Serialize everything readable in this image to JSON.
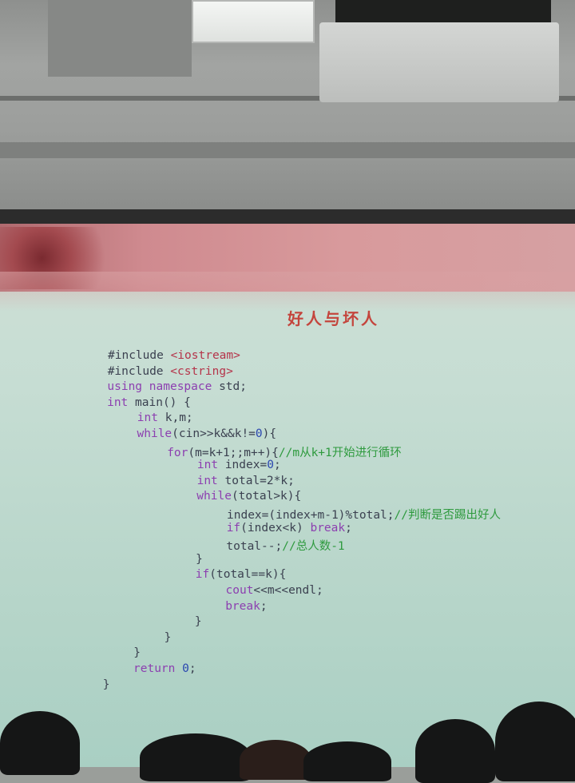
{
  "slide": {
    "title": "好人与坏人",
    "code_lines": [
      {
        "indent": 0,
        "parts": [
          {
            "t": "#include ",
            "c": "plain"
          },
          {
            "t": "<iostream>",
            "c": "str"
          }
        ]
      },
      {
        "indent": 0,
        "parts": [
          {
            "t": "#include ",
            "c": "plain"
          },
          {
            "t": "<cstring>",
            "c": "str"
          }
        ]
      },
      {
        "indent": 0,
        "parts": [
          {
            "t": "using namespace",
            "c": "kw"
          },
          {
            "t": " std;",
            "c": "plain"
          }
        ]
      },
      {
        "indent": 0,
        "parts": [
          {
            "t": "int",
            "c": "kw"
          },
          {
            "t": " main() {",
            "c": "plain"
          }
        ]
      },
      {
        "indent": 1,
        "parts": [
          {
            "t": "int",
            "c": "kw"
          },
          {
            "t": " k,m;",
            "c": "plain"
          }
        ]
      },
      {
        "indent": 1,
        "parts": [
          {
            "t": "while",
            "c": "kw"
          },
          {
            "t": "(cin>>k&&k!=",
            "c": "plain"
          },
          {
            "t": "0",
            "c": "num"
          },
          {
            "t": "){",
            "c": "plain"
          }
        ]
      },
      {
        "indent": 2,
        "parts": [
          {
            "t": "for",
            "c": "kw"
          },
          {
            "t": "(m=k+1;;m++){",
            "c": "plain"
          },
          {
            "t": "//m从k+1开始进行循环",
            "c": "cmt"
          }
        ]
      },
      {
        "indent": 3,
        "parts": [
          {
            "t": "int",
            "c": "kw"
          },
          {
            "t": " index=",
            "c": "plain"
          },
          {
            "t": "0",
            "c": "num"
          },
          {
            "t": ";",
            "c": "plain"
          }
        ]
      },
      {
        "indent": 3,
        "parts": [
          {
            "t": "int",
            "c": "kw"
          },
          {
            "t": " total=2*k;",
            "c": "plain"
          }
        ]
      },
      {
        "indent": 3,
        "parts": [
          {
            "t": "while",
            "c": "kw"
          },
          {
            "t": "(total>k){",
            "c": "plain"
          }
        ]
      },
      {
        "indent": 4,
        "parts": [
          {
            "t": "index=(index+m-1)%total;",
            "c": "plain"
          },
          {
            "t": "//判断是否踢出好人",
            "c": "cmt"
          }
        ]
      },
      {
        "indent": 4,
        "parts": [
          {
            "t": "if",
            "c": "kw"
          },
          {
            "t": "(index<k) ",
            "c": "plain"
          },
          {
            "t": "break",
            "c": "kw"
          },
          {
            "t": ";",
            "c": "plain"
          }
        ]
      },
      {
        "indent": 4,
        "parts": [
          {
            "t": "total--;",
            "c": "plain"
          },
          {
            "t": "//总人数-1",
            "c": "cmt"
          }
        ]
      },
      {
        "indent": 3,
        "parts": [
          {
            "t": "}",
            "c": "plain"
          }
        ]
      },
      {
        "indent": 3,
        "parts": [
          {
            "t": "if",
            "c": "kw"
          },
          {
            "t": "(total==k){",
            "c": "plain"
          }
        ]
      },
      {
        "indent": 4,
        "parts": [
          {
            "t": "cout",
            "c": "kw"
          },
          {
            "t": "<<m<<endl;",
            "c": "plain"
          }
        ]
      },
      {
        "indent": 4,
        "parts": [
          {
            "t": "break",
            "c": "kw"
          },
          {
            "t": ";",
            "c": "plain"
          }
        ]
      },
      {
        "indent": 3,
        "parts": [
          {
            "t": "}",
            "c": "plain"
          }
        ]
      },
      {
        "indent": 2,
        "parts": [
          {
            "t": "}",
            "c": "plain"
          }
        ]
      },
      {
        "indent": 1,
        "parts": [
          {
            "t": "}",
            "c": "plain"
          }
        ]
      },
      {
        "indent": 1,
        "parts": [
          {
            "t": "return ",
            "c": "kw"
          },
          {
            "t": "0",
            "c": "num"
          },
          {
            "t": ";",
            "c": "plain"
          }
        ]
      },
      {
        "indent": 0,
        "parts": [
          {
            "t": "}",
            "c": "plain"
          }
        ]
      }
    ]
  },
  "colors": {
    "title": "#c4453d",
    "keyword": "#8c3fb0",
    "string": "#b5344a",
    "comment": "#2e9a3e",
    "number": "#2a46b0",
    "plain": "#3b4150"
  }
}
